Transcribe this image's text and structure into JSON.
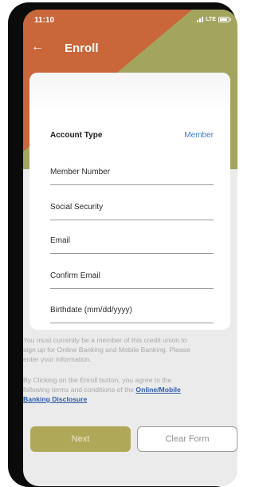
{
  "status_bar": {
    "time": "11:10",
    "network": "LTE"
  },
  "header": {
    "title": "Enroll",
    "back_icon": "arrow-left-icon"
  },
  "colors": {
    "orange": "#c9663a",
    "green": "#a3a55f",
    "button_gold": "#b0a859",
    "link_blue": "#3a7ed8"
  },
  "form": {
    "account_type_label": "Account Type",
    "account_type_value": "Member",
    "fields": [
      "Member Number",
      "Social Security",
      "Email",
      "Confirm Email",
      "Birthdate (mm/dd/yyyy)"
    ]
  },
  "notes": {
    "membership_line1": "You must currently be a member of this credit union to",
    "membership_line2": "sign up for Online Banking and Mobile Banking. Please",
    "membership_line3": "enter your information.",
    "terms_line1": "By Clicking on the Enroll button, you agree to the",
    "terms_line2_prefix": "following terms and conditions of the ",
    "terms_link_part1": "Online/Mobile",
    "terms_link_part2": "Banking Disclosure"
  },
  "buttons": {
    "next": "Next",
    "clear": "Clear Form"
  }
}
